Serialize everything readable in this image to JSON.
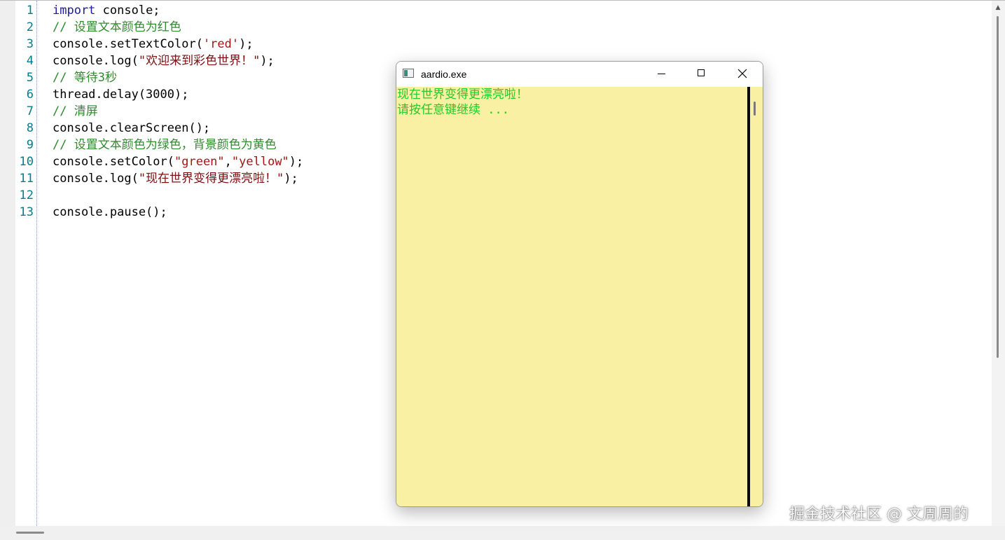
{
  "editor": {
    "line_numbers": [
      "1",
      "2",
      "3",
      "4",
      "5",
      "6",
      "7",
      "8",
      "9",
      "10",
      "11",
      "12",
      "13"
    ],
    "lines": {
      "l1": {
        "kw": "import",
        "rest": " console;"
      },
      "l2": {
        "comment": "// 设置文本颜色为红色"
      },
      "l3": {
        "pre": "console.setTextColor(",
        "str": "'red'",
        "post": ");"
      },
      "l4": {
        "pre": "console.log(",
        "str": "\"欢迎来到彩色世界！\"",
        "post": ");"
      },
      "l5": {
        "comment": "// 等待3秒"
      },
      "l6": {
        "text": "thread.delay(3000);"
      },
      "l7": {
        "comment": "// 清屏"
      },
      "l8": {
        "text": "console.clearScreen();"
      },
      "l9": {
        "comment": "// 设置文本颜色为绿色，背景颜色为黄色"
      },
      "l10": {
        "pre": "console.setColor(",
        "str1": "\"green\"",
        "mid": ",",
        "str2": "\"yellow\"",
        "post": ");"
      },
      "l11": {
        "pre": "console.log(",
        "str": "\"现在世界变得更漂亮啦！\"",
        "post": ");"
      },
      "l12": {
        "text": ""
      },
      "l13": {
        "text": "console.pause();"
      }
    }
  },
  "console_window": {
    "title": "aardio.exe",
    "output": [
      "现在世界变得更漂亮啦！",
      "请按任意键继续 ..."
    ],
    "background_color": "#f9f0a4",
    "text_color": "#22cc22"
  },
  "watermark": "掘金技术社区 @ 文周周的",
  "colors": {
    "keyword": "#1a1aa6",
    "comment": "#2e8b2e",
    "string": "#a31515",
    "line_number": "#0b7a8a"
  }
}
